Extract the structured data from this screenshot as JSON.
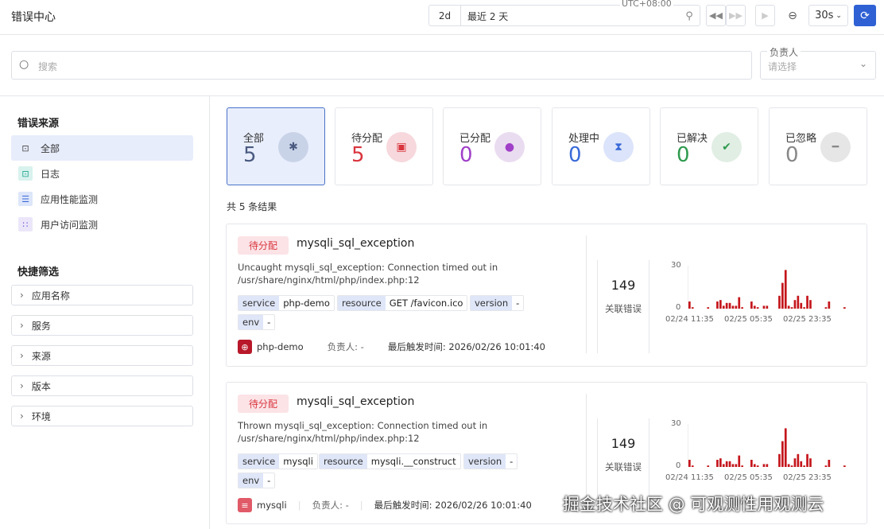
{
  "header": {
    "title": "错误中心",
    "range_short": "2d",
    "range_label": "最近 2 天",
    "timezone": "UTC+08:00",
    "refresh_interval": "30s"
  },
  "search": {
    "placeholder": "搜索"
  },
  "owner_filter": {
    "label": "负责人",
    "placeholder": "请选择"
  },
  "sidebar": {
    "source_title": "错误来源",
    "sources": [
      {
        "label": "全部",
        "icon": "search-doc-icon",
        "active": true
      },
      {
        "label": "日志",
        "icon": "log-icon"
      },
      {
        "label": "应用性能监测",
        "icon": "apm-icon"
      },
      {
        "label": "用户访问监测",
        "icon": "rum-icon"
      }
    ],
    "filter_title": "快捷筛选",
    "filters": [
      "应用名称",
      "服务",
      "来源",
      "版本",
      "环境"
    ]
  },
  "stats": [
    {
      "label": "全部",
      "value": "5",
      "color": "#4a5a80",
      "bg": "#c9d3e8",
      "icon": "bug-icon",
      "glyph": "✱"
    },
    {
      "label": "待分配",
      "value": "5",
      "color": "#d9363e",
      "bg": "#f7d8dc",
      "icon": "inbox-icon",
      "glyph": "▣"
    },
    {
      "label": "已分配",
      "value": "0",
      "color": "#a040c8",
      "bg": "#eadcf0",
      "icon": "user-check-icon",
      "glyph": "●"
    },
    {
      "label": "处理中",
      "value": "0",
      "color": "#3a6ad8",
      "bg": "#dbe4fa",
      "icon": "hourglass-icon",
      "glyph": "⧗"
    },
    {
      "label": "已解决",
      "value": "0",
      "color": "#2e9a4e",
      "bg": "#e1eee4",
      "icon": "check-icon",
      "glyph": "✔"
    },
    {
      "label": "已忽略",
      "value": "0",
      "color": "#888888",
      "bg": "#e6e6e6",
      "icon": "minus-icon",
      "glyph": "━"
    }
  ],
  "result_summary": "共 5 条结果",
  "issues": [
    {
      "status": "待分配",
      "title": "mysqli_sql_exception",
      "message": "Uncaught mysqli_sql_exception: Connection timed out in /usr/share/nginx/html/php/index.php:12",
      "tags": [
        {
          "k": "service",
          "v": "php-demo"
        },
        {
          "k": "resource",
          "v": "GET /favicon.ico"
        },
        {
          "k": "version",
          "v": "-"
        },
        {
          "k": "env",
          "v": "-"
        }
      ],
      "service": "php-demo",
      "owner": "负责人: -",
      "last_seen": "最后触发时间: 2026/02/26 10:01:40",
      "count": "149",
      "count_label": "关联错误"
    },
    {
      "status": "待分配",
      "title": "mysqli_sql_exception",
      "message": "Thrown mysqli_sql_exception: Connection timed out in /usr/share/nginx/html/php/index.php:12",
      "tags": [
        {
          "k": "service",
          "v": "mysqli"
        },
        {
          "k": "resource",
          "v": "mysqli.__construct"
        },
        {
          "k": "version",
          "v": "-"
        },
        {
          "k": "env",
          "v": "-"
        }
      ],
      "service": "mysqli",
      "owner": "负责人: -",
      "last_seen": "最后触发时间: 2026/02/26 10:01:40",
      "count": "149",
      "count_label": "关联错误"
    }
  ],
  "chart_data": {
    "type": "bar",
    "color": "#c4161c",
    "ylim": [
      0,
      30
    ],
    "yticks": [
      "30",
      "0"
    ],
    "xticks": [
      "02/24 11:35",
      "02/25 05:35",
      "02/25 23:35"
    ],
    "values": [
      5,
      1,
      0,
      0,
      0,
      0,
      1,
      0,
      0,
      5,
      6,
      2,
      4,
      4,
      2,
      2,
      8,
      1,
      0,
      0,
      5,
      2,
      1,
      0,
      2,
      2,
      0,
      0,
      0,
      9,
      18,
      27,
      2,
      1,
      6,
      9,
      4,
      1,
      9,
      6,
      0,
      0,
      0,
      0,
      1,
      5,
      0,
      0,
      0,
      0,
      1
    ]
  },
  "watermark": "掘金技术社区 @ 可观测性用观测云"
}
